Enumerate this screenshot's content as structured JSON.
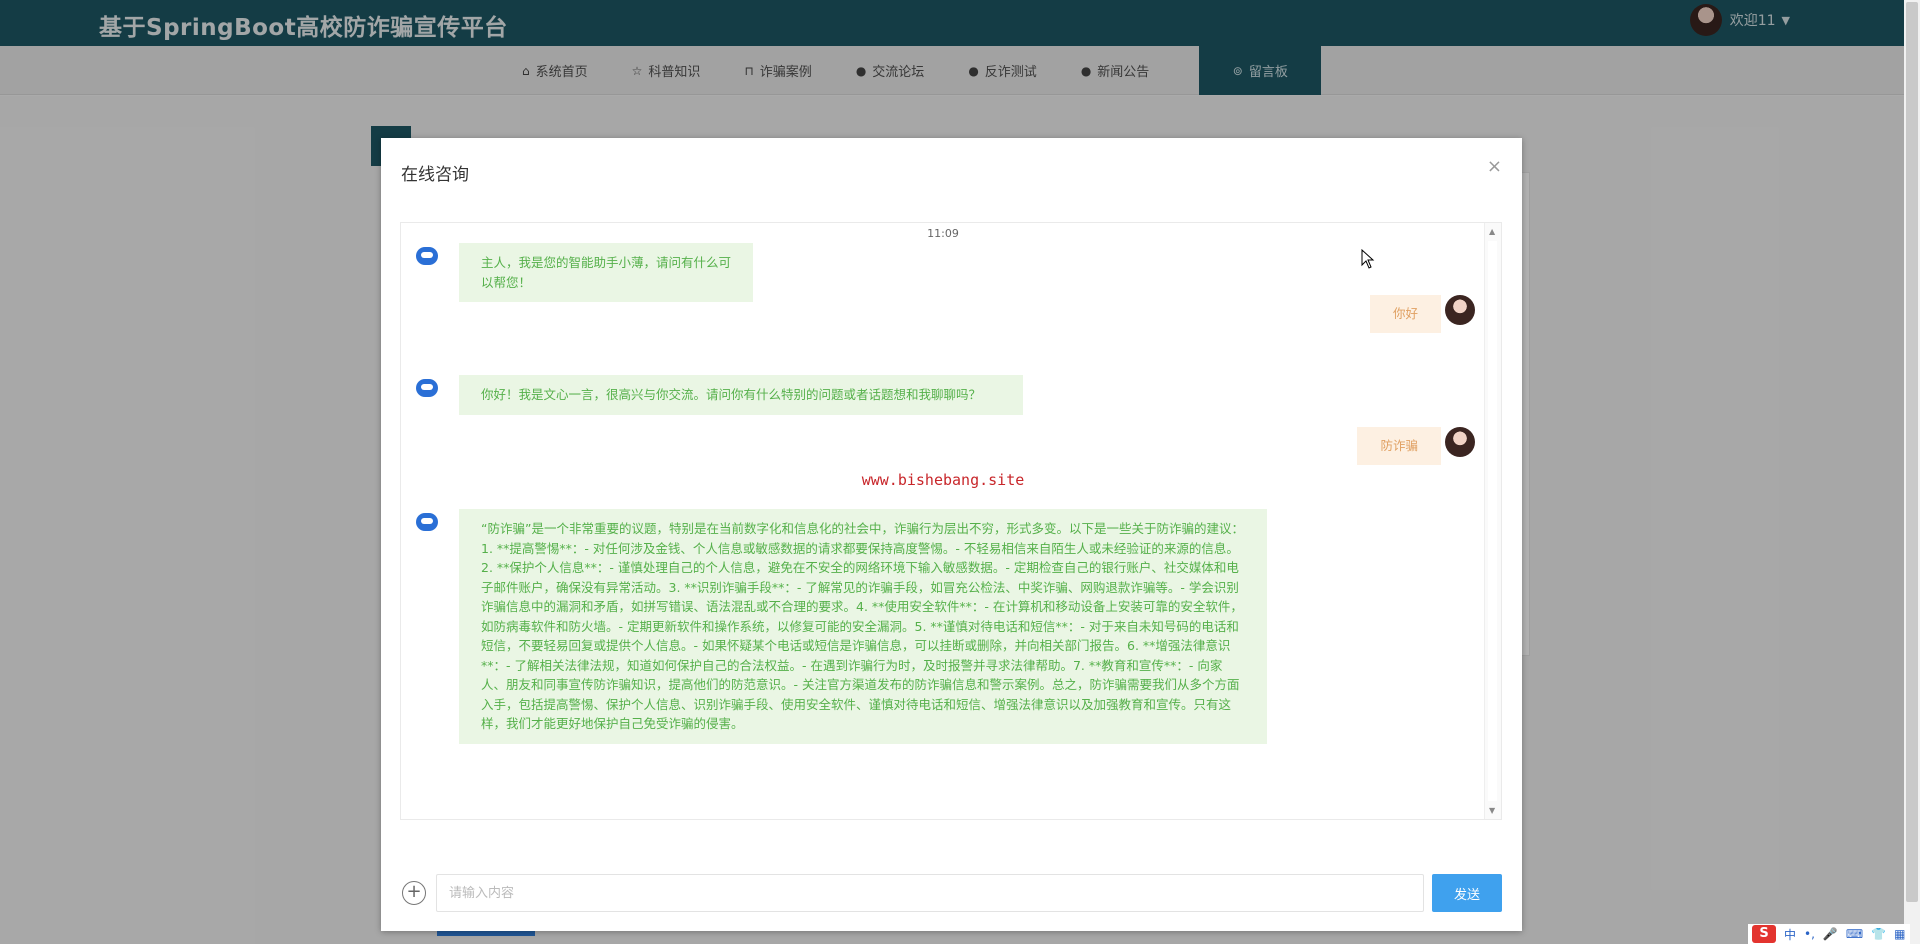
{
  "header": {
    "site_title": "基于SpringBoot高校防诈骗宣传平台",
    "welcome_text": "欢迎11"
  },
  "nav": {
    "items": [
      {
        "label": "系统首页",
        "icon": "home-icon"
      },
      {
        "label": "科普知识",
        "icon": "star-icon"
      },
      {
        "label": "诈骗案例",
        "icon": "lock-icon"
      },
      {
        "label": "交流论坛",
        "icon": "info-icon"
      },
      {
        "label": "反诈测试",
        "icon": "question-icon"
      },
      {
        "label": "新闻公告",
        "icon": "info-icon"
      },
      {
        "label": "留言板",
        "icon": "settings-icon"
      }
    ],
    "active_index": 6
  },
  "dialog": {
    "title": "在线咨询",
    "close_symbol": "×",
    "timestamp": "11:09",
    "watermark": "www.bishebang.site",
    "messages": [
      {
        "from": "bot",
        "text": "主人，我是您的智能助手小薄，请问有什么可以帮您！"
      },
      {
        "from": "user",
        "text": "你好"
      },
      {
        "from": "bot",
        "text": "你好！我是文心一言，很高兴与你交流。请问你有什么特别的问题或者话题想和我聊聊吗？"
      },
      {
        "from": "user",
        "text": "防诈骗"
      },
      {
        "from": "bot",
        "text": "“防诈骗”是一个非常重要的议题，特别是在当前数字化和信息化的社会中，诈骗行为层出不穷，形式多变。以下是一些关于防诈骗的建议：1. **提高警惕**：- 对任何涉及金钱、个人信息或敏感数据的请求都要保持高度警惕。- 不轻易相信来自陌生人或未经验证的来源的信息。2. **保护个人信息**：- 谨慎处理自己的个人信息，避免在不安全的网络环境下输入敏感数据。- 定期检查自己的银行账户、社交媒体和电子邮件账户，确保没有异常活动。3. **识别诈骗手段**：- 了解常见的诈骗手段，如冒充公检法、中奖诈骗、网购退款诈骗等。- 学会识别诈骗信息中的漏洞和矛盾，如拼写错误、语法混乱或不合理的要求。4. **使用安全软件**：- 在计算机和移动设备上安装可靠的安全软件，如防病毒软件和防火墙。- 定期更新软件和操作系统，以修复可能的安全漏洞。5. **谨慎对待电话和短信**：- 对于来自未知号码的电话和短信，不要轻易回复或提供个人信息。- 如果怀疑某个电话或短信是诈骗信息，可以挂断或删除，并向相关部门报告。6. **增强法律意识**：- 了解相关法律法规，知道如何保护自己的合法权益。- 在遇到诈骗行为时，及时报警并寻求法律帮助。7. **教育和宣传**：- 向家人、朋友和同事宣传防诈骗知识，提高他们的防范意识。- 关注官方渠道发布的防诈骗信息和警示案例。总之，防诈骗需要我们从多个方面入手，包括提高警惕、保护个人信息、识别诈骗手段、使用安全软件、谨慎对待电话和短信、增强法律意识以及加强教育和宣传。只有这样，我们才能更好地保护自己免受诈骗的侵害。"
      }
    ],
    "input_placeholder": "请输入内容",
    "input_value": "",
    "send_label": "发送",
    "add_symbol": "+"
  },
  "ime": {
    "lang": "中",
    "sogou": "S"
  },
  "colors": {
    "header_bg": "#1e5763",
    "bot_bubble_bg": "#eaf6e4",
    "bot_text": "#55b04a",
    "user_bubble_bg": "#fdf0e2",
    "user_text": "#e0a062",
    "send_button": "#3fa1ee",
    "watermark": "#c8262a"
  }
}
